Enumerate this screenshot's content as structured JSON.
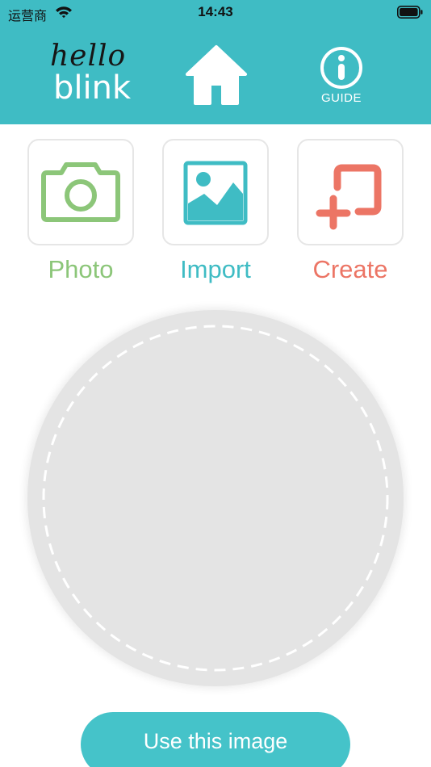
{
  "status_bar": {
    "carrier": "运营商",
    "time": "14:43"
  },
  "header": {
    "logo": {
      "line1": "hello",
      "line2": "blink"
    },
    "home_icon": "home-icon",
    "guide_label": "GUIDE",
    "guide_icon": "info-icon"
  },
  "tools": [
    {
      "label": "Photo",
      "icon": "camera-icon",
      "color": "#8cc679"
    },
    {
      "label": "Import",
      "icon": "image-icon",
      "color": "#3fbcc4"
    },
    {
      "label": "Create",
      "icon": "create-frame-icon",
      "color": "#ec7565"
    }
  ],
  "canvas": {
    "placeholder_icon": "dashed-circle"
  },
  "actions": {
    "use_image_label": "Use this image"
  },
  "colors": {
    "header": "#3fbcc4",
    "button": "#45c3c9",
    "photo": "#8cc679",
    "import": "#3fbcc4",
    "create": "#ec7565",
    "canvas": "#e4e4e4"
  }
}
